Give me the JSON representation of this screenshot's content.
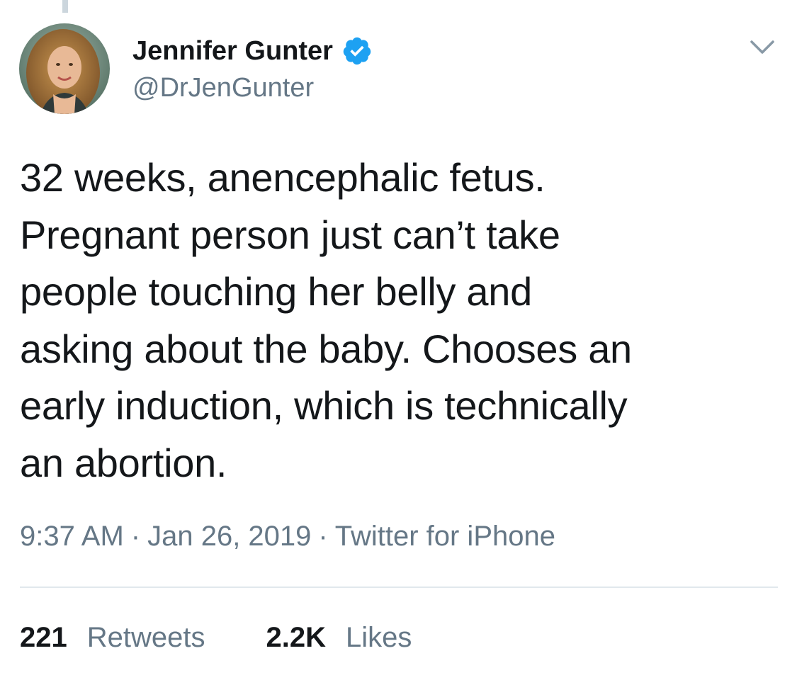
{
  "tweet": {
    "author": {
      "name": "Jennifer Gunter",
      "handle": "@DrJenGunter",
      "verified": true
    },
    "text_lines": [
      "32 weeks, anencephalic fetus.",
      "Pregnant person just can’t take",
      "people touching her belly and",
      "asking about the baby. Chooses an",
      "early induction, which is technically",
      "an abortion."
    ],
    "meta": {
      "time": "9:37 AM",
      "separator": "·",
      "date": "Jan 26, 2019",
      "source": "Twitter for iPhone"
    },
    "stats": {
      "retweets_count": "221",
      "retweets_label": "Retweets",
      "likes_count": "2.2K",
      "likes_label": "Likes"
    }
  },
  "icons": {
    "verified": "verified-badge-icon",
    "caret": "chevron-down-icon"
  },
  "colors": {
    "text_primary": "#14171a",
    "text_secondary": "#657786",
    "verified_blue": "#1da1f2",
    "divider": "#e1e8ed"
  }
}
